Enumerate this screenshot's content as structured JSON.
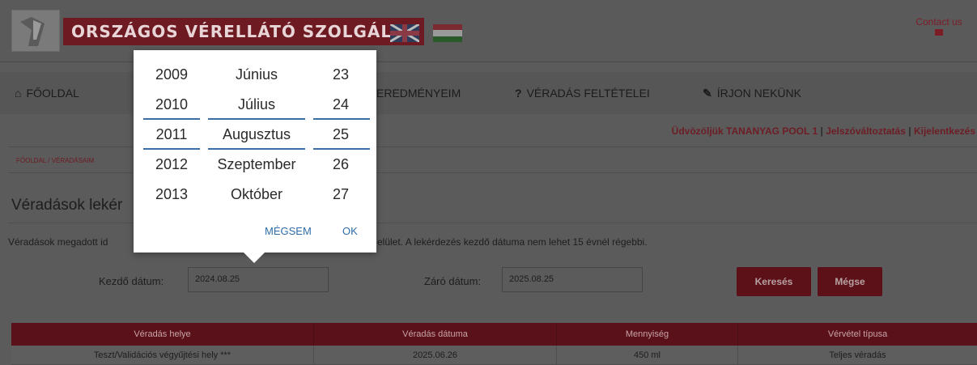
{
  "header": {
    "logo_text": "ORSZÁGOS VÉRELLÁTÓ SZOLGÁLAT",
    "contact_label": "Contact us"
  },
  "nav": {
    "items": [
      {
        "icon": "home-icon",
        "label": "FŐOLDAL"
      },
      {
        "icon": "chart-icon",
        "label": "EREDMÉNYEIM"
      },
      {
        "icon": "question-icon",
        "label": "VÉRADÁS FELTÉTELEI"
      },
      {
        "icon": "pencil-icon",
        "label": "ÍRJON NEKÜNK"
      }
    ]
  },
  "welcome": {
    "greeting": "Üdvözöljük TANANYAG POOL 1",
    "separator": "|",
    "change_password": "Jelszóváltoztatás",
    "logout": "Kijelentkezés"
  },
  "breadcrumb": "FŐOLDAL / VÉRADÁSAIM",
  "page_title": "Véradások lekér",
  "description": {
    "left": "Véradások megadott id",
    "right": "elület. A lekérdezés kezdő dátuma nem lehet 15 évnél régebbi."
  },
  "form": {
    "start_label": "Kezdő dátum:",
    "start_value": "2024.08.25",
    "end_label": "Záró dátum:",
    "end_value": "2025.08.25",
    "search_button": "Keresés",
    "cancel_button": "Mégse"
  },
  "table": {
    "headers": [
      "Véradás helye",
      "Véradás dátuma",
      "Mennyiség",
      "Vérvétel típusa"
    ],
    "rows": [
      [
        "Teszt/Validációs végyűjtési hely ***",
        "2025.06.26",
        "450 ml",
        "Teljes véradás"
      ]
    ]
  },
  "date_picker": {
    "years": [
      "2009",
      "2010",
      "2011",
      "2012",
      "2013"
    ],
    "months": [
      "Június",
      "Július",
      "Augusztus",
      "Szeptember",
      "Október"
    ],
    "days": [
      "23",
      "24",
      "25",
      "26",
      "27"
    ],
    "selected": {
      "year": "2011",
      "month": "Augusztus",
      "day": "25"
    },
    "cancel_label": "MÉGSEM",
    "ok_label": "OK"
  },
  "colors": {
    "brand": "#7c1d27",
    "picker_accent": "#2f6ca8"
  }
}
